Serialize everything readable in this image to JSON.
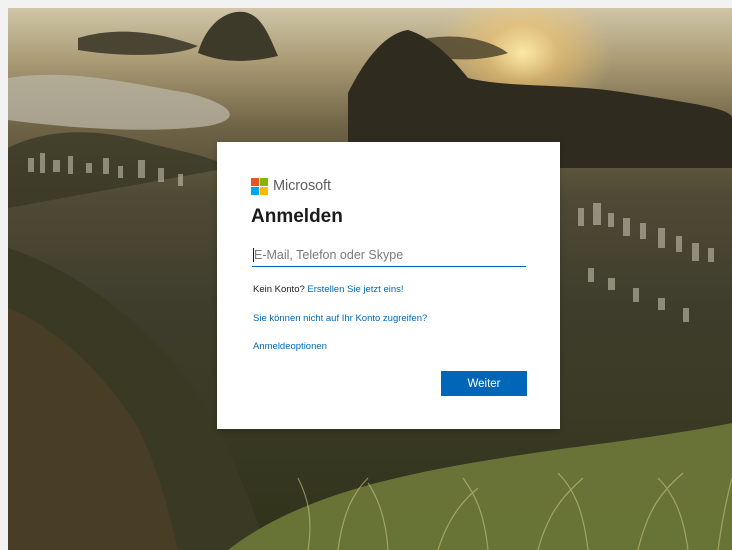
{
  "brand": {
    "name": "Microsoft",
    "logo_colors": [
      "#f25022",
      "#7fba00",
      "#00a4ef",
      "#ffb900"
    ]
  },
  "signin": {
    "title": "Anmelden",
    "email_placeholder": "E-Mail, Telefon oder Skype",
    "email_value": "",
    "no_account_text": "Kein Konto?",
    "create_link": "Erstellen Sie jetzt eins!",
    "cant_access_link": "Sie können nicht auf Ihr Konto zugreifen?",
    "signin_options_link": "Anmeldeoptionen",
    "next_button": "Weiter"
  },
  "colors": {
    "accent": "#0067b8",
    "card_background": "#ffffff",
    "title_text": "#1b1b1b"
  }
}
